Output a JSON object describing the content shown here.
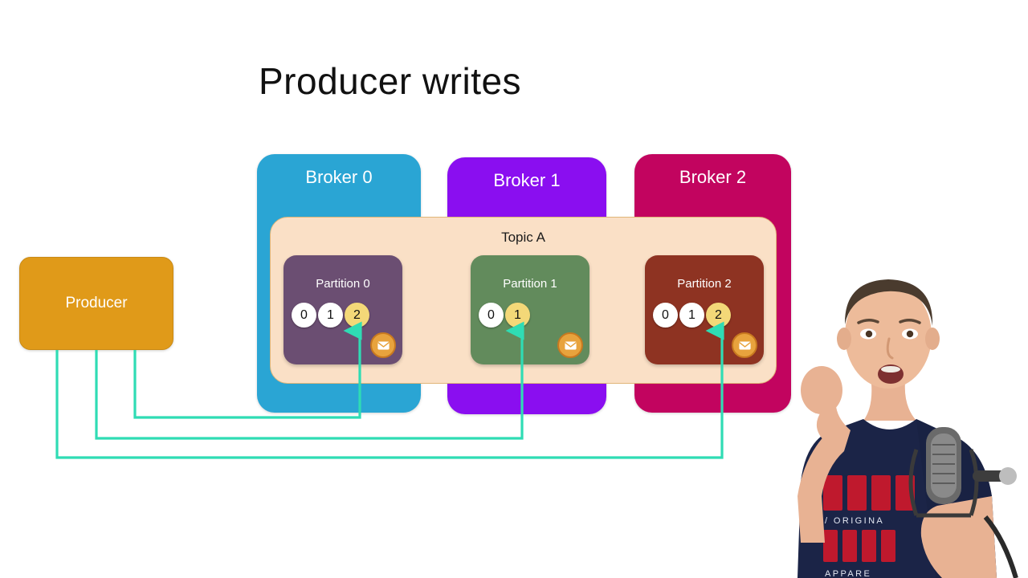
{
  "slide": {
    "title": "Producer writes",
    "background": "#ffffff"
  },
  "producer": {
    "label": "Producer",
    "color": "#e09a19"
  },
  "topic": {
    "label": "Topic A",
    "color": "#fae0c6",
    "border_color": "#e0b679"
  },
  "brokers": [
    {
      "label": "Broker 0",
      "color": "#2aa5d4"
    },
    {
      "label": "Broker 1",
      "color": "#8a0ef0"
    },
    {
      "label": "Broker 2",
      "color": "#c2045f"
    }
  ],
  "partitions": [
    {
      "label": "Partition 0",
      "color": "#6b4e72",
      "offsets": [
        "0",
        "1",
        "2"
      ],
      "latest_offset": "2",
      "badge_icon": "envelope-icon"
    },
    {
      "label": "Partition 1",
      "color": "#628b5c",
      "offsets": [
        "0",
        "1"
      ],
      "latest_offset": "1",
      "badge_icon": "envelope-icon"
    },
    {
      "label": "Partition 2",
      "color": "#8e3322",
      "offsets": [
        "0",
        "1",
        "2"
      ],
      "latest_offset": "2",
      "badge_icon": "envelope-icon"
    }
  ],
  "write_arrows": {
    "color": "#2fdcb4",
    "count": 3,
    "targets": [
      "Partition 0",
      "Partition 1",
      "Partition 2"
    ]
  },
  "presenter": {
    "shirt_color": "#1b2447",
    "shirt_text_color": "#c8192c",
    "shirt_text_lines": [
      "/ ORIGINAL",
      "APPAREL"
    ],
    "microphone_color": "#4a4a4a"
  }
}
